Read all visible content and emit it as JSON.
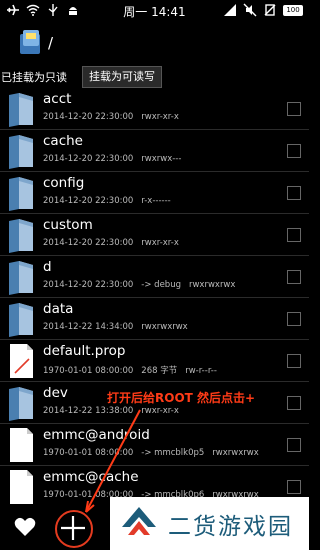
{
  "status_bar": {
    "time": "周一 14:41",
    "battery": "100"
  },
  "header": {
    "path": "/"
  },
  "mount": {
    "status": "已挂载为只读",
    "button_label": "挂载为可读写"
  },
  "files": [
    {
      "name": "acct",
      "date": "2014-12-20 22:30:00",
      "perms": "rwxr-xr-x",
      "extra": "",
      "type": "folder"
    },
    {
      "name": "cache",
      "date": "2014-12-20 22:30:00",
      "perms": "rwxrwx---",
      "extra": "",
      "type": "folder"
    },
    {
      "name": "config",
      "date": "2014-12-20 22:30:00",
      "perms": "r-x------",
      "extra": "",
      "type": "folder"
    },
    {
      "name": "custom",
      "date": "2014-12-20 22:30:00",
      "perms": "rwxr-xr-x",
      "extra": "",
      "type": "folder"
    },
    {
      "name": "d",
      "date": "2014-12-20 22:30:00",
      "perms": "rwxrwxrwx",
      "extra": "-> debug",
      "type": "link-folder"
    },
    {
      "name": "data",
      "date": "2014-12-22 14:34:00",
      "perms": "rwxrwxrwx",
      "extra": "",
      "type": "folder"
    },
    {
      "name": "default.prop",
      "date": "1970-01-01 08:00:00",
      "perms": "rw-r--r--",
      "extra": "268 字节",
      "type": "file"
    },
    {
      "name": "dev",
      "date": "2014-12-22 13:38:00",
      "perms": "rwxr-xr-x",
      "extra": "",
      "type": "folder"
    },
    {
      "name": "emmc@android",
      "date": "1970-01-01 08:00:00",
      "perms": "rwxrwxrwx",
      "extra": "-> mmcblk0p5",
      "type": "file"
    },
    {
      "name": "emmc@cache",
      "date": "1970-01-01 08:00:00",
      "perms": "rwxrwxrwx",
      "extra": "-> mmcblk0p6",
      "type": "file"
    }
  ],
  "annotation": "打开后给ROOT 然后点击+",
  "watermark": "二货游戏园",
  "colors": {
    "annotation": "#ff3b17",
    "folder_light": "#a7c4e0",
    "folder_dark": "#4a7fb0",
    "watermark_text": "#1d5c7a"
  }
}
